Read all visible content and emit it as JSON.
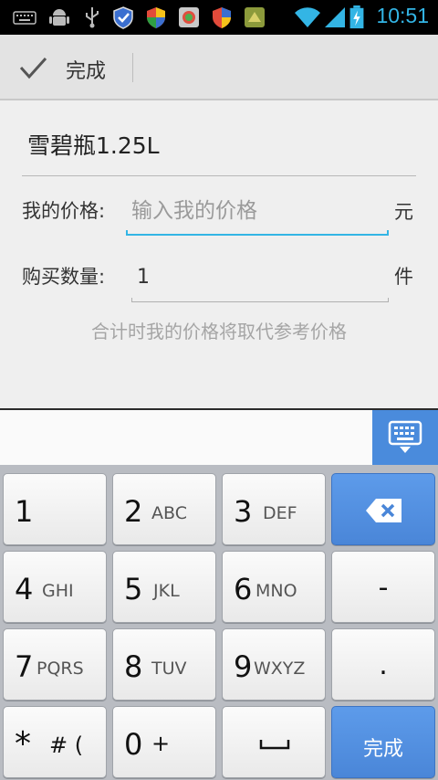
{
  "status_bar": {
    "time": "10:51",
    "icons": [
      "keyboard-icon",
      "android-debug-icon",
      "usb-icon",
      "shield-blue-icon",
      "shield-color-icon",
      "photo-app-icon",
      "shield-alert-icon",
      "app-icon",
      "wifi-icon",
      "signal-icon",
      "battery-charging-icon"
    ]
  },
  "action_bar": {
    "done_label": "完成"
  },
  "form": {
    "product_name": "雪碧瓶1.25L",
    "price_label": "我的价格:",
    "price_placeholder": "输入我的价格",
    "price_unit": "元",
    "qty_label": "购买数量:",
    "qty_value": "1",
    "qty_unit": "件",
    "hint": "合计时我的价格将取代参考价格"
  },
  "keyboard": {
    "switch_icon": "keyboard-hide-icon",
    "keys": [
      {
        "main": "1",
        "sub": ""
      },
      {
        "main": "2",
        "sub": "ABC"
      },
      {
        "main": "3",
        "sub": "DEF"
      },
      {
        "main": "4",
        "sub": "GHI"
      },
      {
        "main": "5",
        "sub": "JKL"
      },
      {
        "main": "6",
        "sub": "MNO"
      },
      {
        "main": "7",
        "sub": "PQRS"
      },
      {
        "main": "8",
        "sub": "TUV"
      },
      {
        "main": "9",
        "sub": "WXYZ"
      },
      {
        "main": "*",
        "sub": "# ("
      },
      {
        "main": "0",
        "sub": "+"
      }
    ],
    "minus": "-",
    "dot": ".",
    "done": "完成"
  }
}
